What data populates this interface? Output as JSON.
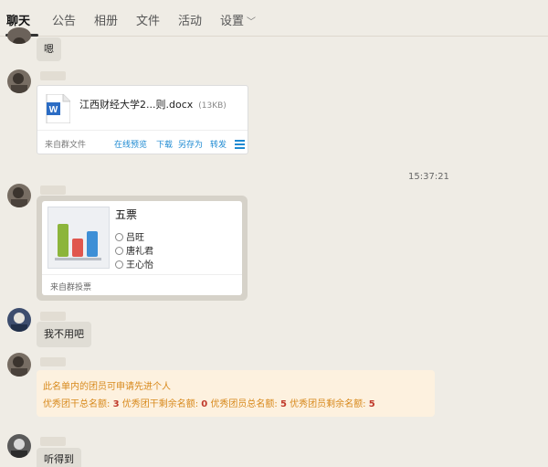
{
  "tabs": [
    "聊天",
    "公告",
    "相册",
    "文件",
    "活动",
    "设置"
  ],
  "messages": [
    {
      "text": "嗯"
    },
    {
      "file": {
        "name": "江西财经大学2...则.docx",
        "size": "(13KB)",
        "source": "来自群文件",
        "actions": [
          "在线预览",
          "下载",
          "另存为",
          "转发"
        ]
      }
    },
    {
      "timestamp": "15:37:21"
    },
    {
      "vote": {
        "title": "五票",
        "options": [
          "吕旺",
          "唐礼君",
          "王心怡"
        ],
        "source": "来自群投票"
      }
    },
    {
      "text": "我不用吧"
    },
    {
      "notice": {
        "line1": "此名单内的团员可申请先进个人",
        "items": [
          {
            "label": "优秀团干总名额:",
            "value": "3"
          },
          {
            "label": "优秀团干剩余名额:",
            "value": "0"
          },
          {
            "label": "优秀团员总名额:",
            "value": "5"
          },
          {
            "label": "优秀团员剩余名额:",
            "value": "5"
          }
        ]
      }
    },
    {
      "text": "听得到"
    }
  ],
  "icons": {
    "file": "word-doc-icon",
    "menu": "hamburger-menu-icon",
    "vote": "bar-chart-icon",
    "dropdown": "chevron-down-icon"
  },
  "colors": {
    "link": "#1e8ad2",
    "notice_text": "#d8891c",
    "notice_number": "#c0392b",
    "notice_bg": "#fdf1df"
  }
}
